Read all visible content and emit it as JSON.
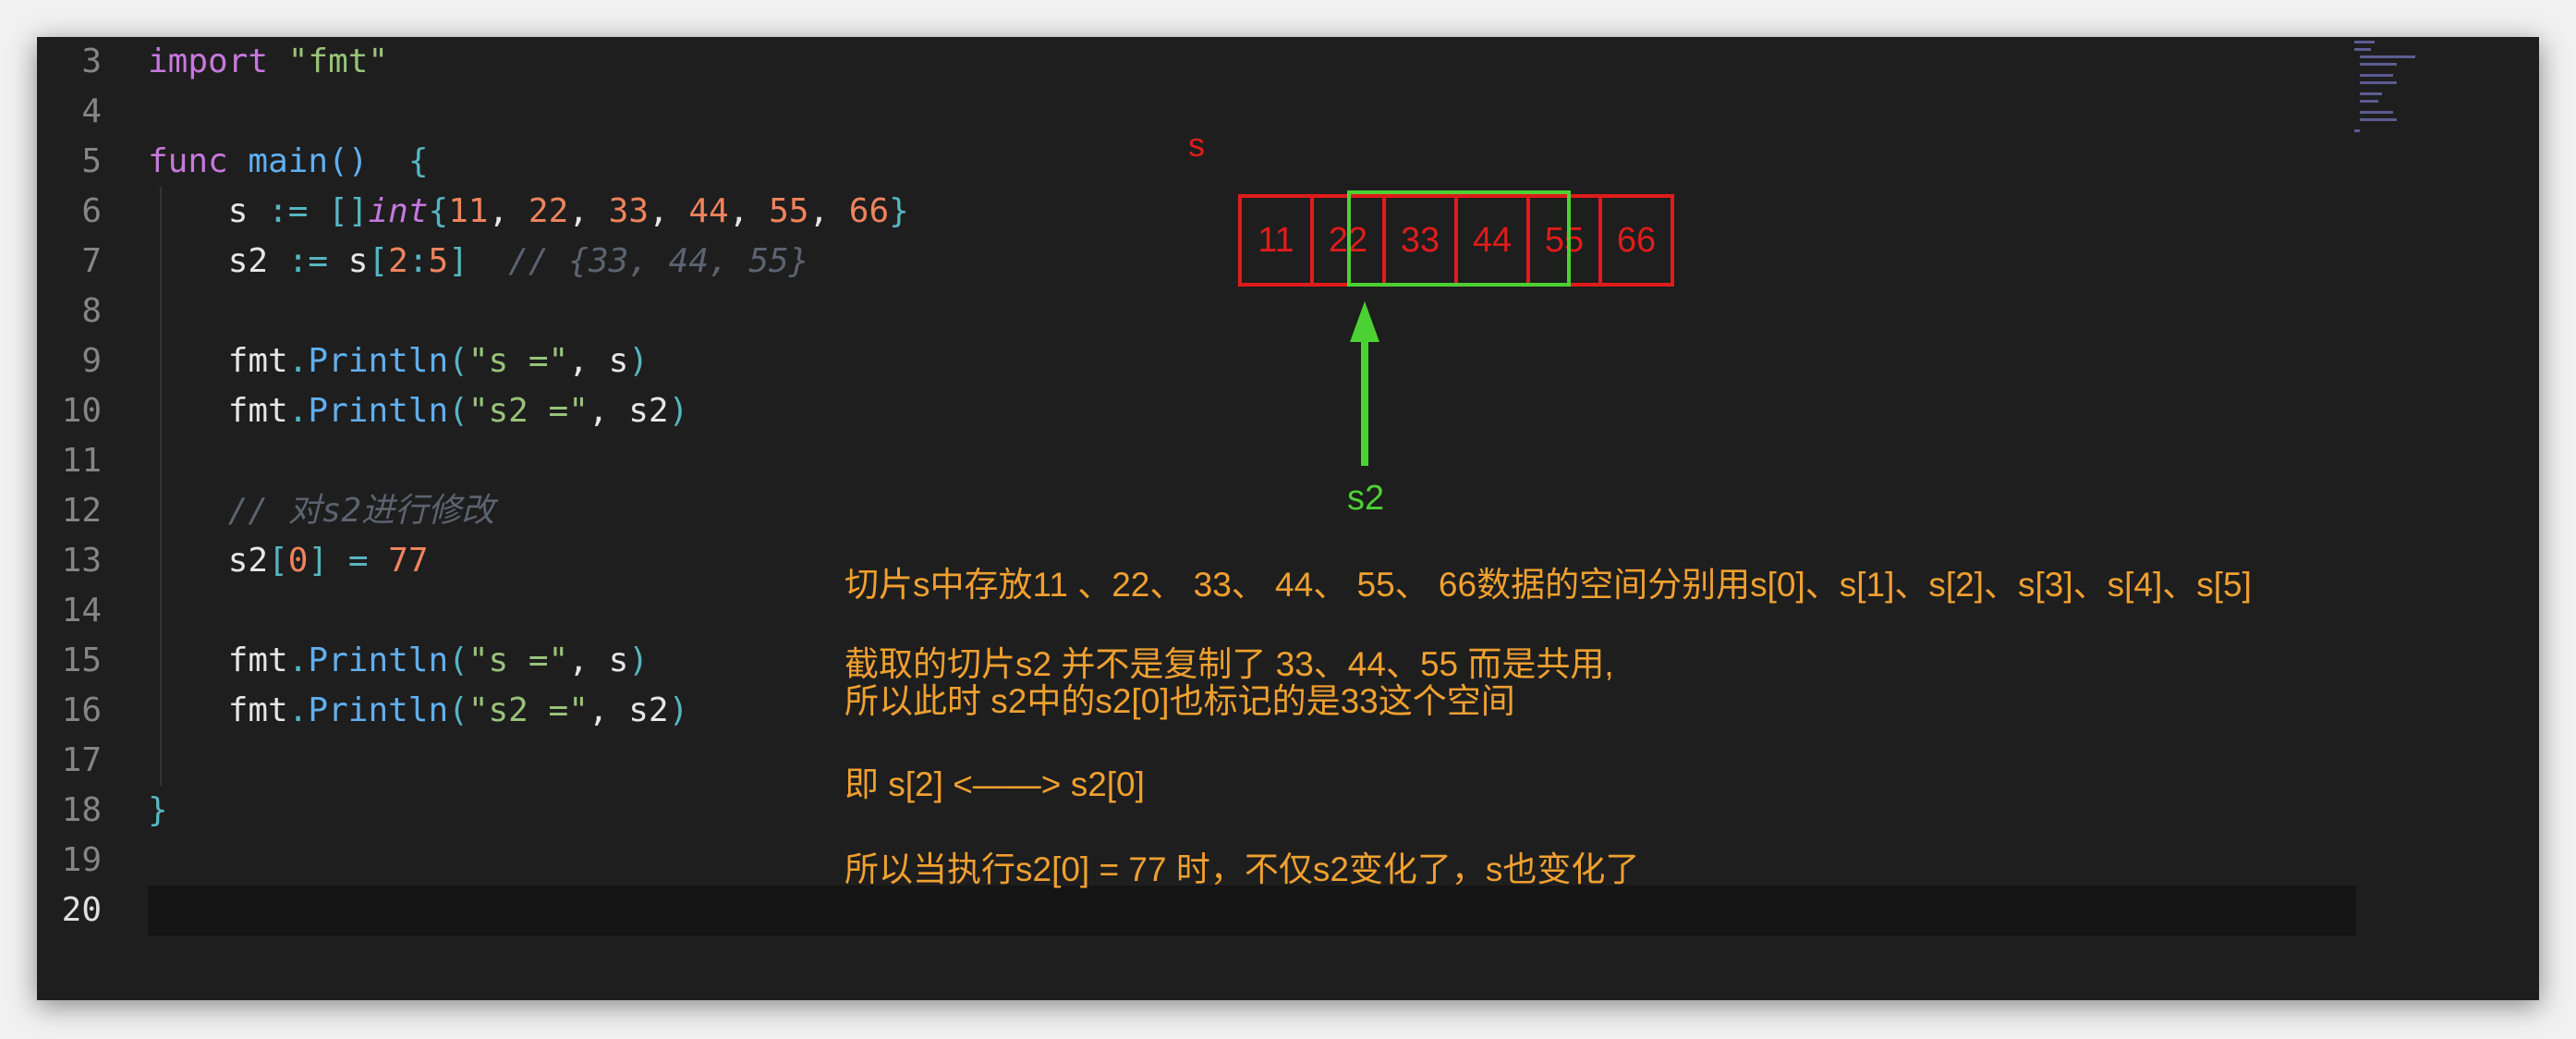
{
  "editor": {
    "line_numbers": [
      "3",
      "4",
      "5",
      "6",
      "7",
      "8",
      "9",
      "10",
      "11",
      "12",
      "13",
      "14",
      "15",
      "16",
      "17",
      "18",
      "19",
      "20"
    ],
    "active_line": "20",
    "code": {
      "l3_kw": "import",
      "l3_str": "\"fmt\"",
      "l5_kw": "func",
      "l5_fn": "main",
      "l5_parens": "()",
      "l5_brace": "{",
      "l6_ident": "s",
      "l6_op": ":=",
      "l6_br": "[]",
      "l6_type": "int",
      "l6_open": "{",
      "l6_nums": [
        "11",
        "22",
        "33",
        "44",
        "55",
        "66"
      ],
      "l6_close": "}",
      "l7_ident": "s2",
      "l7_op": ":=",
      "l7_s": "s",
      "l7_lb": "[",
      "l7_a": "2",
      "l7_colon": ":",
      "l7_b": "5",
      "l7_rb": "]",
      "l7_cmt": "// {33, 44, 55}",
      "l9_pkg": "fmt",
      "l9_fn": "Println",
      "l9_str": "\"s =\"",
      "l9_arg": "s",
      "l10_pkg": "fmt",
      "l10_fn": "Println",
      "l10_str": "\"s2 =\"",
      "l10_arg": "s2",
      "l12_cmt": "// 对s2进行修改",
      "l13_ident": "s2",
      "l13_idx": "0",
      "l13_val": "77",
      "l15_pkg": "fmt",
      "l15_fn": "Println",
      "l15_str": "\"s =\"",
      "l15_arg": "s",
      "l16_pkg": "fmt",
      "l16_fn": "Println",
      "l16_str": "\"s2 =\"",
      "l16_arg": "s2",
      "l18_brace": "}"
    }
  },
  "diagram": {
    "slice_label": "s",
    "cells": [
      "11",
      "22",
      "33",
      "44",
      "55",
      "66"
    ],
    "pointer_label": "s2",
    "colors": {
      "slice": "#e01b1b",
      "subslice": "#4cd133",
      "notes": "#f0a030"
    }
  },
  "notes": {
    "line1": "切片s中存放11 、22、 33、 44、 55、 66数据的空间分别用s[0]、s[1]、s[2]、s[3]、s[4]、s[5]",
    "line2": "截取的切片s2 并不是复制了 33、44、55 而是共用,",
    "line3": "所以此时 s2中的s2[0]也标记的是33这个空间",
    "line4": "即 s[2] <——> s2[0]",
    "line5": "所以当执行s2[0] = 77 时，不仅s2变化了，s也变化了"
  }
}
